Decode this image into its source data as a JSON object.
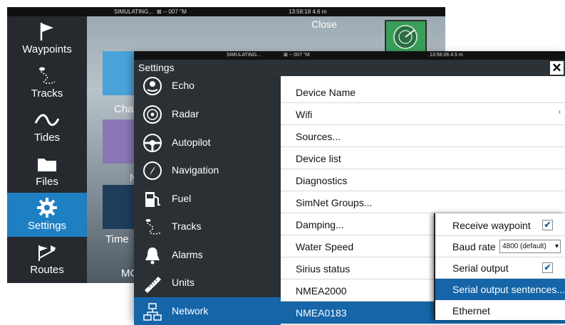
{
  "background": {
    "status": {
      "left": "SIMULATING...",
      "mid": "⊠ -- 007 °M",
      "time": "13:58:18  4.6 m"
    },
    "close_label": "Close",
    "left_bar": [
      {
        "label": "Waypoints",
        "icon": "flag-icon"
      },
      {
        "label": "Tracks",
        "icon": "track-icon"
      },
      {
        "label": "Tides",
        "icon": "wave-icon"
      },
      {
        "label": "Files",
        "icon": "folder-icon"
      },
      {
        "label": "Settings",
        "icon": "gear-icon",
        "active": true
      },
      {
        "label": "Routes",
        "icon": "route-icon"
      }
    ],
    "app_labels": [
      "Cha",
      "Na",
      "Time",
      "MC"
    ]
  },
  "dialog": {
    "status": {
      "left": "SIMULATING...",
      "mid": "⊠ -- 007 °M",
      "time": "13:56:06  4.5 m"
    },
    "title": "Settings",
    "close_symbol": "✕",
    "sidebar": [
      {
        "label": "Echo",
        "icon": "echo-icon"
      },
      {
        "label": "Radar",
        "icon": "radar-icon"
      },
      {
        "label": "Autopilot",
        "icon": "helm-icon"
      },
      {
        "label": "Navigation",
        "icon": "compass-icon"
      },
      {
        "label": "Fuel",
        "icon": "fuel-icon"
      },
      {
        "label": "Tracks",
        "icon": "track-icon"
      },
      {
        "label": "Alarms",
        "icon": "bell-icon"
      },
      {
        "label": "Units",
        "icon": "ruler-icon"
      },
      {
        "label": "Network",
        "icon": "network-icon",
        "active": true
      }
    ],
    "menu": [
      {
        "label": "Device Name"
      },
      {
        "label": "Wifi",
        "arrow": "›"
      },
      {
        "label": "Sources..."
      },
      {
        "label": "Device list"
      },
      {
        "label": "Diagnostics"
      },
      {
        "label": "SimNet Groups..."
      },
      {
        "label": "Damping..."
      },
      {
        "label": "Water Speed"
      },
      {
        "label": "Sirius status"
      },
      {
        "label": "NMEA2000"
      },
      {
        "label": "NMEA0183",
        "active": true
      }
    ],
    "popup": [
      {
        "label": "Receive waypoint",
        "checked": true
      },
      {
        "label": "Baud rate",
        "value": "4800 (default)"
      },
      {
        "label": "Serial output",
        "checked": true
      },
      {
        "label": "Serial output sentences...",
        "active": true
      },
      {
        "label": "Ethernet"
      }
    ],
    "check_symbol": "✔",
    "dropdown_symbol": "▾"
  },
  "colors": {
    "accent": "#1565a8",
    "sidebar_bg": "#2b3035",
    "left_bar_bg": "#262a2e"
  }
}
